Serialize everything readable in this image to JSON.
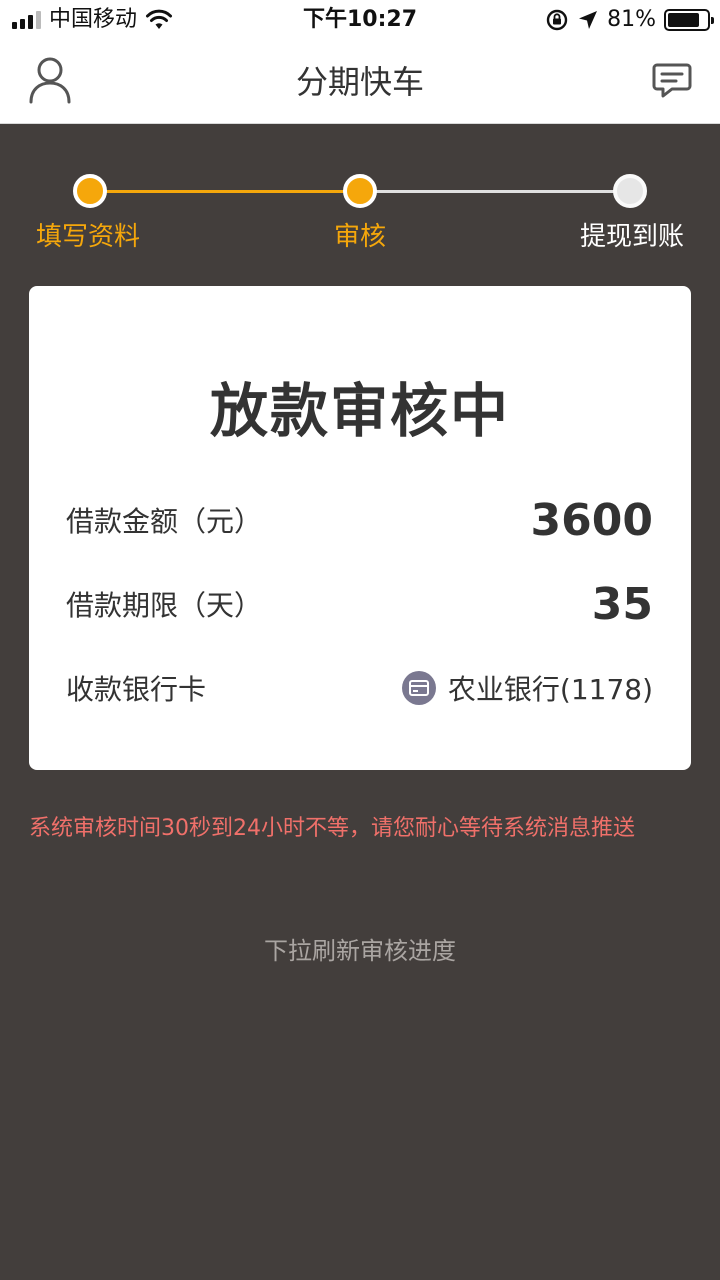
{
  "status_bar": {
    "carrier": "中国移动",
    "time": "下午10:27",
    "battery_percent": "81%",
    "battery_level": 0.81
  },
  "nav": {
    "title": "分期快车",
    "left_icon": "user-icon",
    "right_icon": "message-icon"
  },
  "steps": [
    {
      "label": "填写资料",
      "state": "done"
    },
    {
      "label": "审核",
      "state": "current"
    },
    {
      "label": "提现到账",
      "state": "pending"
    }
  ],
  "card": {
    "title": "放款审核中",
    "rows": [
      {
        "label": "借款金额（元）",
        "value": "3600"
      },
      {
        "label": "借款期限（天）",
        "value": "35"
      },
      {
        "label": "收款银行卡",
        "value": "农业银行(1178)",
        "icon": "bank-card-icon"
      }
    ]
  },
  "notice": "系统审核时间30秒到24小时不等，请您耐心等待系统消息推送",
  "refresh_hint": "下拉刷新审核进度",
  "colors": {
    "accent": "#f5a70b",
    "background": "#433e3c",
    "notice": "#f0706a",
    "hint": "#aaa5a2"
  }
}
